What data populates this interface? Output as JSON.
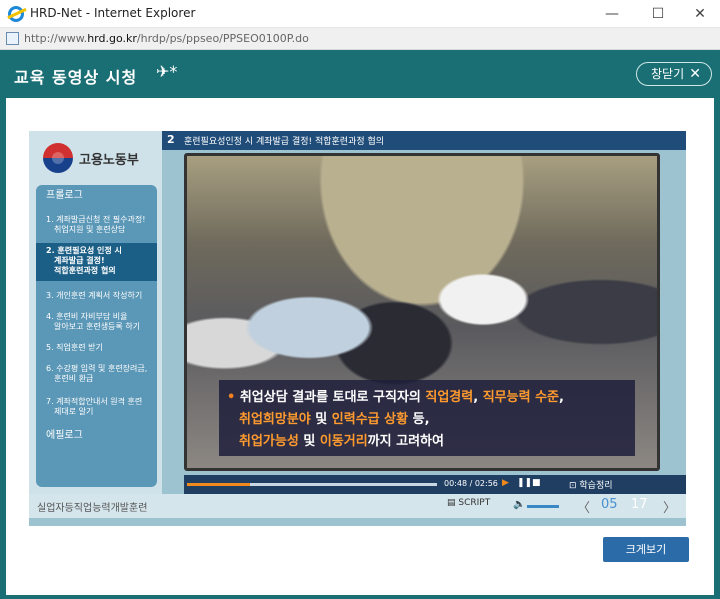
{
  "window": {
    "title": "HRD-Net - Internet Explorer",
    "min": "—",
    "max": "☐",
    "close": "✕"
  },
  "address": {
    "prefix": "http://www.",
    "domain": "hrd.go.kr",
    "path": "/hrdp/ps/ppseo/PPSEO0100P.do"
  },
  "header": {
    "title": "교육 동영상 시청",
    "deco": "✈*",
    "close_label": "창닫기",
    "close_icon": "✕"
  },
  "org": {
    "name": "고용노동부"
  },
  "menu": {
    "items": [
      {
        "label": "프롤로그"
      },
      {
        "label": "1. 계좌발급신청 전 필수과정!"
      },
      {
        "label": "취업지원 및 훈련상담"
      },
      {
        "label": "2. 훈련필요성 인정 시"
      },
      {
        "label": "계좌발급 결정!"
      },
      {
        "label": "적합훈련과정 협의"
      },
      {
        "label": "3. 개인훈련 계획서 작성하기"
      },
      {
        "label": "4. 훈련비 자비부담 비율"
      },
      {
        "label": "알아보고 훈련생등록 하기"
      },
      {
        "label": "5. 직업훈련 받기"
      },
      {
        "label": "6. 수강평 입력 및 훈련장려금,"
      },
      {
        "label": "훈련비 환급"
      },
      {
        "label": "7. 계좌적합안내서 원격 훈련"
      },
      {
        "label": "제대로 알기"
      },
      {
        "label": "에필로그"
      }
    ]
  },
  "lesson": {
    "number": "2",
    "title": "훈련필요성인정 시 계좌발급 결정! 적합훈련과정 협의"
  },
  "caption": {
    "l1a": "취업상담 결과를 토대로 구직자의 ",
    "l1b": "직업경력",
    "l1c": ", ",
    "l1d": "직무능력 수준",
    "l1e": ",",
    "l2a": "취업희망분야",
    "l2b": " 및 ",
    "l2c": "인력수급 상황",
    "l2d": " 등,",
    "l3a": "취업가능성",
    "l3b": " 및 ",
    "l3c": "이동거리",
    "l3d": "까지 고려하여"
  },
  "controls": {
    "time": "00:48 / 02:56",
    "play": "▶",
    "pause": "❚❚",
    "stop": "■",
    "review": "학습정리",
    "progress": 0.25
  },
  "bottom": {
    "title": "실업자등직업능력개발훈련",
    "script": "SCRIPT",
    "prev": "〈",
    "page": "05",
    "total": "17",
    "next": "〉"
  },
  "footer": {
    "fullscreen": "크게보기"
  }
}
